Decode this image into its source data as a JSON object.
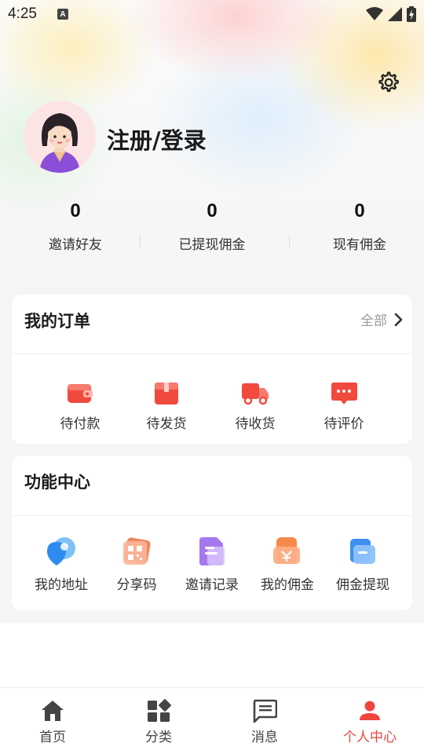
{
  "status_bar": {
    "time": "4:25",
    "notification_letter": "A"
  },
  "profile": {
    "login_label": "注册/登录"
  },
  "stats": [
    {
      "value": "0",
      "label": "邀请好友"
    },
    {
      "value": "0",
      "label": "已提现佣金"
    },
    {
      "value": "0",
      "label": "现有佣金"
    }
  ],
  "orders": {
    "title": "我的订单",
    "all_label": "全部",
    "items": [
      {
        "label": "待付款",
        "icon": "wallet-icon"
      },
      {
        "label": "待发货",
        "icon": "package-icon"
      },
      {
        "label": "待收货",
        "icon": "truck-icon"
      },
      {
        "label": "待评价",
        "icon": "comment-icon"
      }
    ]
  },
  "functions": {
    "title": "功能中心",
    "items": [
      {
        "label": "我的地址",
        "icon": "location-icon"
      },
      {
        "label": "分享码",
        "icon": "qrcode-icon"
      },
      {
        "label": "邀请记录",
        "icon": "document-icon"
      },
      {
        "label": "我的佣金",
        "icon": "commission-icon"
      },
      {
        "label": "佣金提现",
        "icon": "withdraw-icon"
      }
    ]
  },
  "tabbar": {
    "active_color": "#f0443e",
    "items": [
      {
        "label": "首页",
        "icon": "home-icon"
      },
      {
        "label": "分类",
        "icon": "category-icon"
      },
      {
        "label": "消息",
        "icon": "message-icon"
      },
      {
        "label": "个人中心",
        "icon": "person-icon",
        "active": true
      }
    ]
  }
}
